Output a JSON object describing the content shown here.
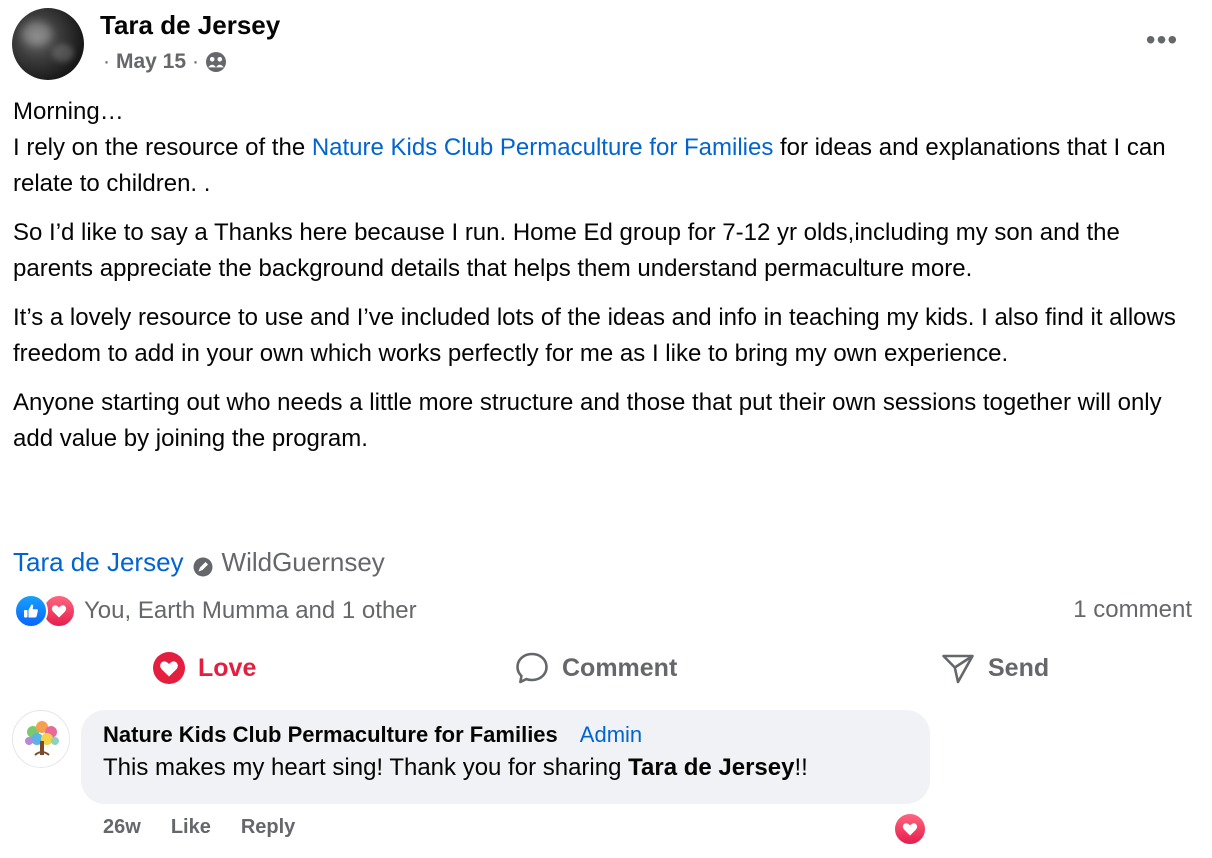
{
  "post": {
    "author": "Tara de Jersey",
    "date": "May 15",
    "separator": "·",
    "audience_icon": "friends-icon",
    "more_icon": "more-horizontal-icon",
    "more_label": "•••"
  },
  "body": {
    "p1_line1": "Morning…",
    "p1_pre": "I rely on the resource of the ",
    "p1_link": "Nature Kids Club  Permaculture for Families",
    "p1_post": " for ideas and explanations that I can relate to children. .",
    "p2": "So I’d like to say a Thanks here because I run. Home Ed group for 7-12 yr olds,including my son and the parents appreciate the background details that helps them understand permaculture more.",
    "p3": "It’s a lovely resource to use and I’ve included lots of the ideas and info in teaching my kids. I also find it allows freedom to add in your own which works perfectly for me as I like to bring my own experience.",
    "p4": "Anyone starting out who needs a little more structure and those that put their own sessions together will only add value by joining the program."
  },
  "tags": {
    "person": "Tara de Jersey",
    "place": "WildGuernsey",
    "place_icon": "location-check-icon"
  },
  "reactions": {
    "summary": "You, Earth Mumma and 1 other",
    "types": [
      "like",
      "love"
    ],
    "comment_count": "1 comment"
  },
  "actions": {
    "love": "Love",
    "comment": "Comment",
    "send": "Send"
  },
  "comment": {
    "author": "Nature Kids Club Permaculture for Families",
    "badge": "Admin",
    "text_pre": "This makes my heart sing! Thank you for sharing ",
    "text_mention": "Tara de Jersey",
    "text_post": "!!",
    "age": "26w",
    "like": "Like",
    "reply": "Reply",
    "reaction": "love"
  },
  "colors": {
    "link": "#0064d1",
    "love": "#e41e3f",
    "like": "#0866ff",
    "secondary_text": "#65676b",
    "bubble": "#f0f2f5"
  }
}
